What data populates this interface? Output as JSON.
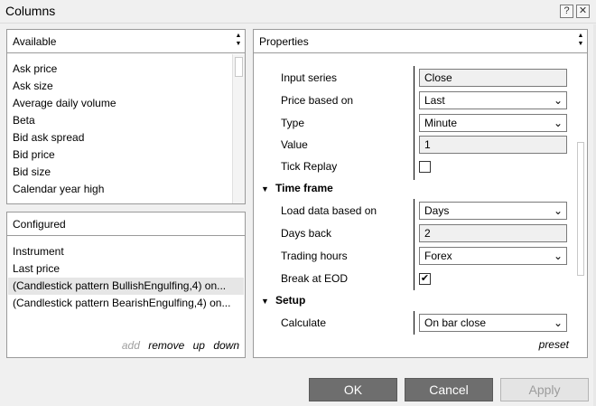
{
  "window": {
    "title": "Columns",
    "help_label": "?",
    "close_label": "✕"
  },
  "available": {
    "header": "Available",
    "items": [
      "Ask price",
      "Ask size",
      "Average daily volume",
      "Beta",
      "Bid ask spread",
      "Bid price",
      "Bid size",
      "Calendar year high"
    ]
  },
  "configured": {
    "header": "Configured",
    "items": [
      "Instrument",
      "Last price",
      "(Candlestick pattern BullishEngulfing,4) on...",
      "(Candlestick pattern BearishEngulfing,4) on..."
    ],
    "selected_index": 2,
    "actions": {
      "add": "add",
      "remove": "remove",
      "up": "up",
      "down": "down"
    }
  },
  "properties": {
    "header": "Properties",
    "rows": {
      "input_series": {
        "label": "Input series",
        "value": "Close"
      },
      "price_based_on": {
        "label": "Price based on",
        "value": "Last"
      },
      "type": {
        "label": "Type",
        "value": "Minute"
      },
      "value": {
        "label": "Value",
        "value": "1"
      },
      "tick_replay": {
        "label": "Tick Replay",
        "checked": false
      },
      "load_data_based_on": {
        "label": "Load data based on",
        "value": "Days"
      },
      "days_back": {
        "label": "Days back",
        "value": "2"
      },
      "trading_hours": {
        "label": "Trading hours",
        "value": "Forex"
      },
      "break_at_eod": {
        "label": "Break at EOD",
        "checked": true
      },
      "calculate": {
        "label": "Calculate",
        "value": "On bar close"
      }
    },
    "sections": {
      "time_frame": "Time frame",
      "setup": "Setup"
    },
    "preset": "preset"
  },
  "footer": {
    "ok": "OK",
    "cancel": "Cancel",
    "apply": "Apply"
  },
  "icons": {
    "chevron": "⌄",
    "check": "✔",
    "sort_up": "▲",
    "sort_down": "▼",
    "expand": "▼"
  },
  "colors": {
    "button_bg": "#6e6e6e",
    "selection_bg": "#e6e6e6",
    "panel_border": "#9a9a9a"
  }
}
